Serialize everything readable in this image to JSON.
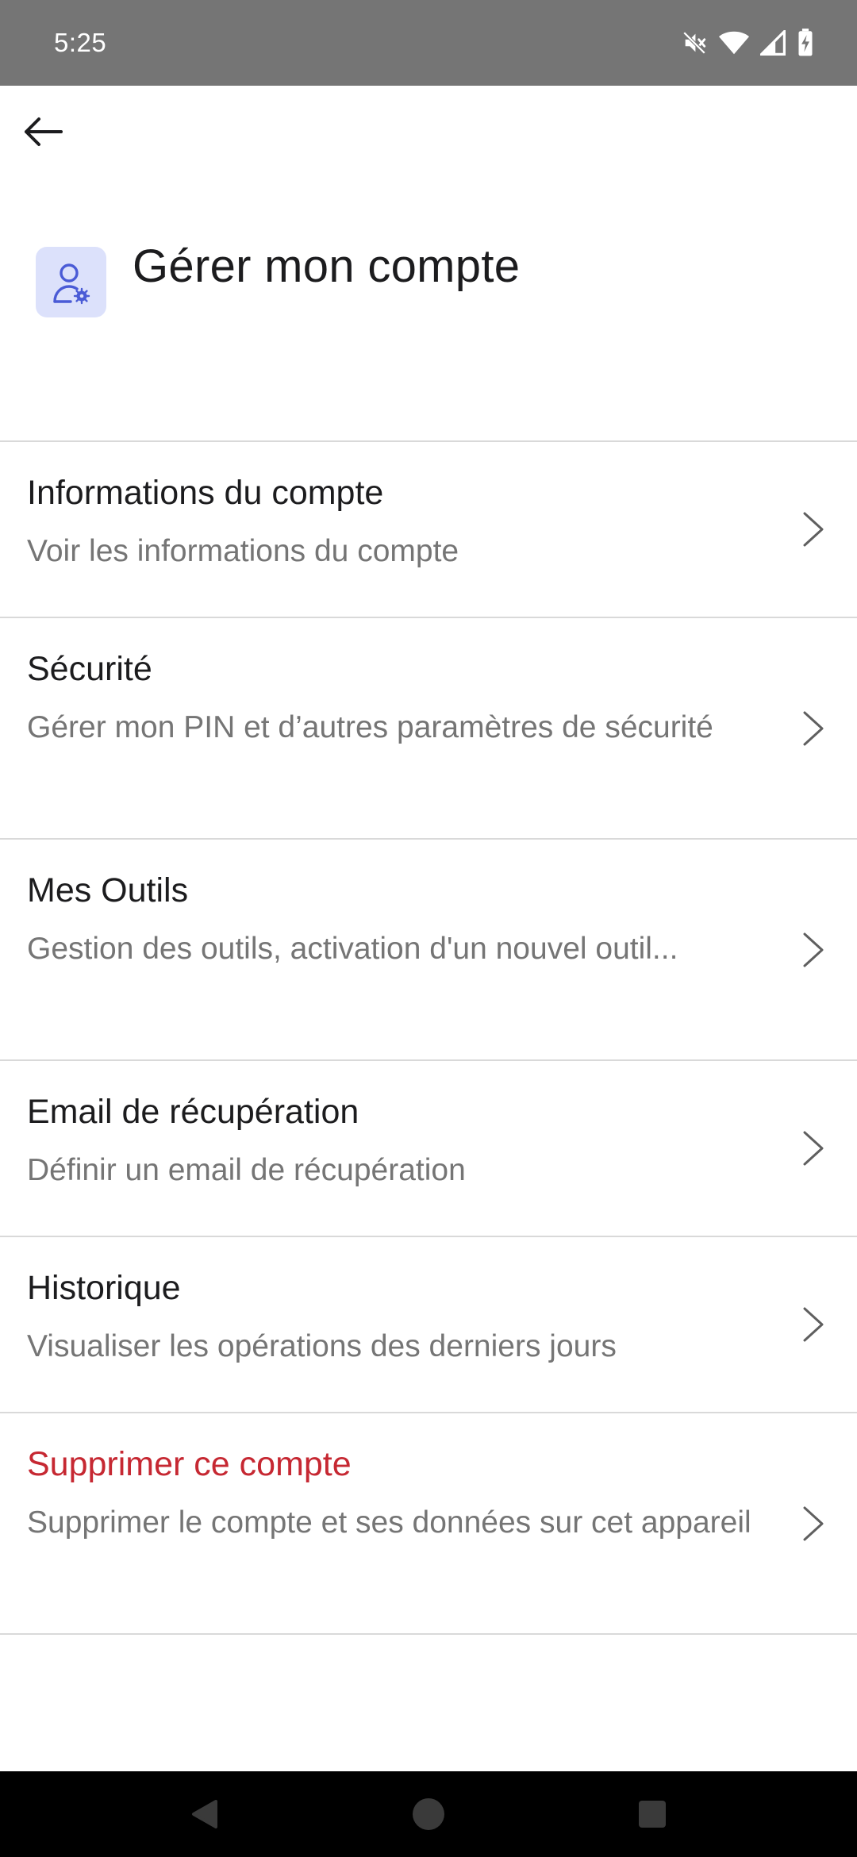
{
  "status_bar": {
    "time": "5:25",
    "icons": [
      "mute-icon",
      "wifi-icon",
      "signal-icon",
      "battery-icon"
    ]
  },
  "app_bar": {
    "back_icon": "arrow-left-icon"
  },
  "header": {
    "icon": "user-settings-icon",
    "title": "Gérer mon compte",
    "accent_color": "#4a5bd6",
    "icon_bg_color": "#dce1fb"
  },
  "menu": {
    "items": [
      {
        "title": "Informations du compte",
        "subtitle": "Voir les informations du compte"
      },
      {
        "title": "Sécurité",
        "subtitle": "Gérer mon PIN et d’autres paramètres de sécurité"
      },
      {
        "title": "Mes Outils",
        "subtitle": "Gestion des outils, activation d'un nouvel outil..."
      },
      {
        "title": "Email de récupération",
        "subtitle": "Définir un email de récupération"
      },
      {
        "title": "Historique",
        "subtitle": "Visualiser les opérations des derniers jours"
      },
      {
        "title": "Supprimer ce compte",
        "subtitle": "Supprimer le compte et ses données sur cet appareil",
        "color": "#c62832"
      }
    ]
  },
  "nav_bar": {
    "icons": [
      "back-triangle-icon",
      "home-circle-icon",
      "recents-square-icon"
    ]
  }
}
